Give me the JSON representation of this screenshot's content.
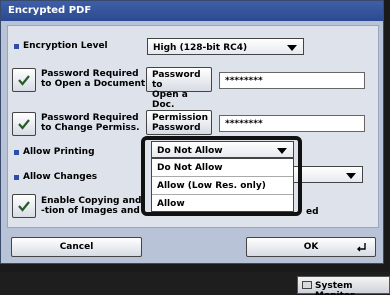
{
  "window": {
    "title": "Encrypted PDF"
  },
  "encryption_level": {
    "label": "Encryption Level",
    "value": "High (128-bit RC4)"
  },
  "open_password": {
    "checkbox_label_line1": "Password Required",
    "checkbox_label_line2": "to Open a Document",
    "button_line1": "Password to",
    "button_line2": "Open a Doc.",
    "value": "********"
  },
  "permission_password": {
    "checkbox_label_line1": "Password Required",
    "checkbox_label_line2": "to Change Permiss.",
    "button_line1": "Permission",
    "button_line2": "Password",
    "value": "********"
  },
  "allow_printing": {
    "label": "Allow Printing",
    "value": "Do Not Allow",
    "options": [
      "Do Not Allow",
      "Allow (Low Res. only)",
      "Allow"
    ]
  },
  "allow_changes": {
    "label": "Allow Changes"
  },
  "enable_copying": {
    "label_line1": "Enable Copying and",
    "label_line2": "-tion of Images and",
    "partial_text": "ed"
  },
  "buttons": {
    "cancel": "Cancel",
    "ok": "OK"
  },
  "status_bar": {
    "system_monitor": "System Monitor"
  }
}
